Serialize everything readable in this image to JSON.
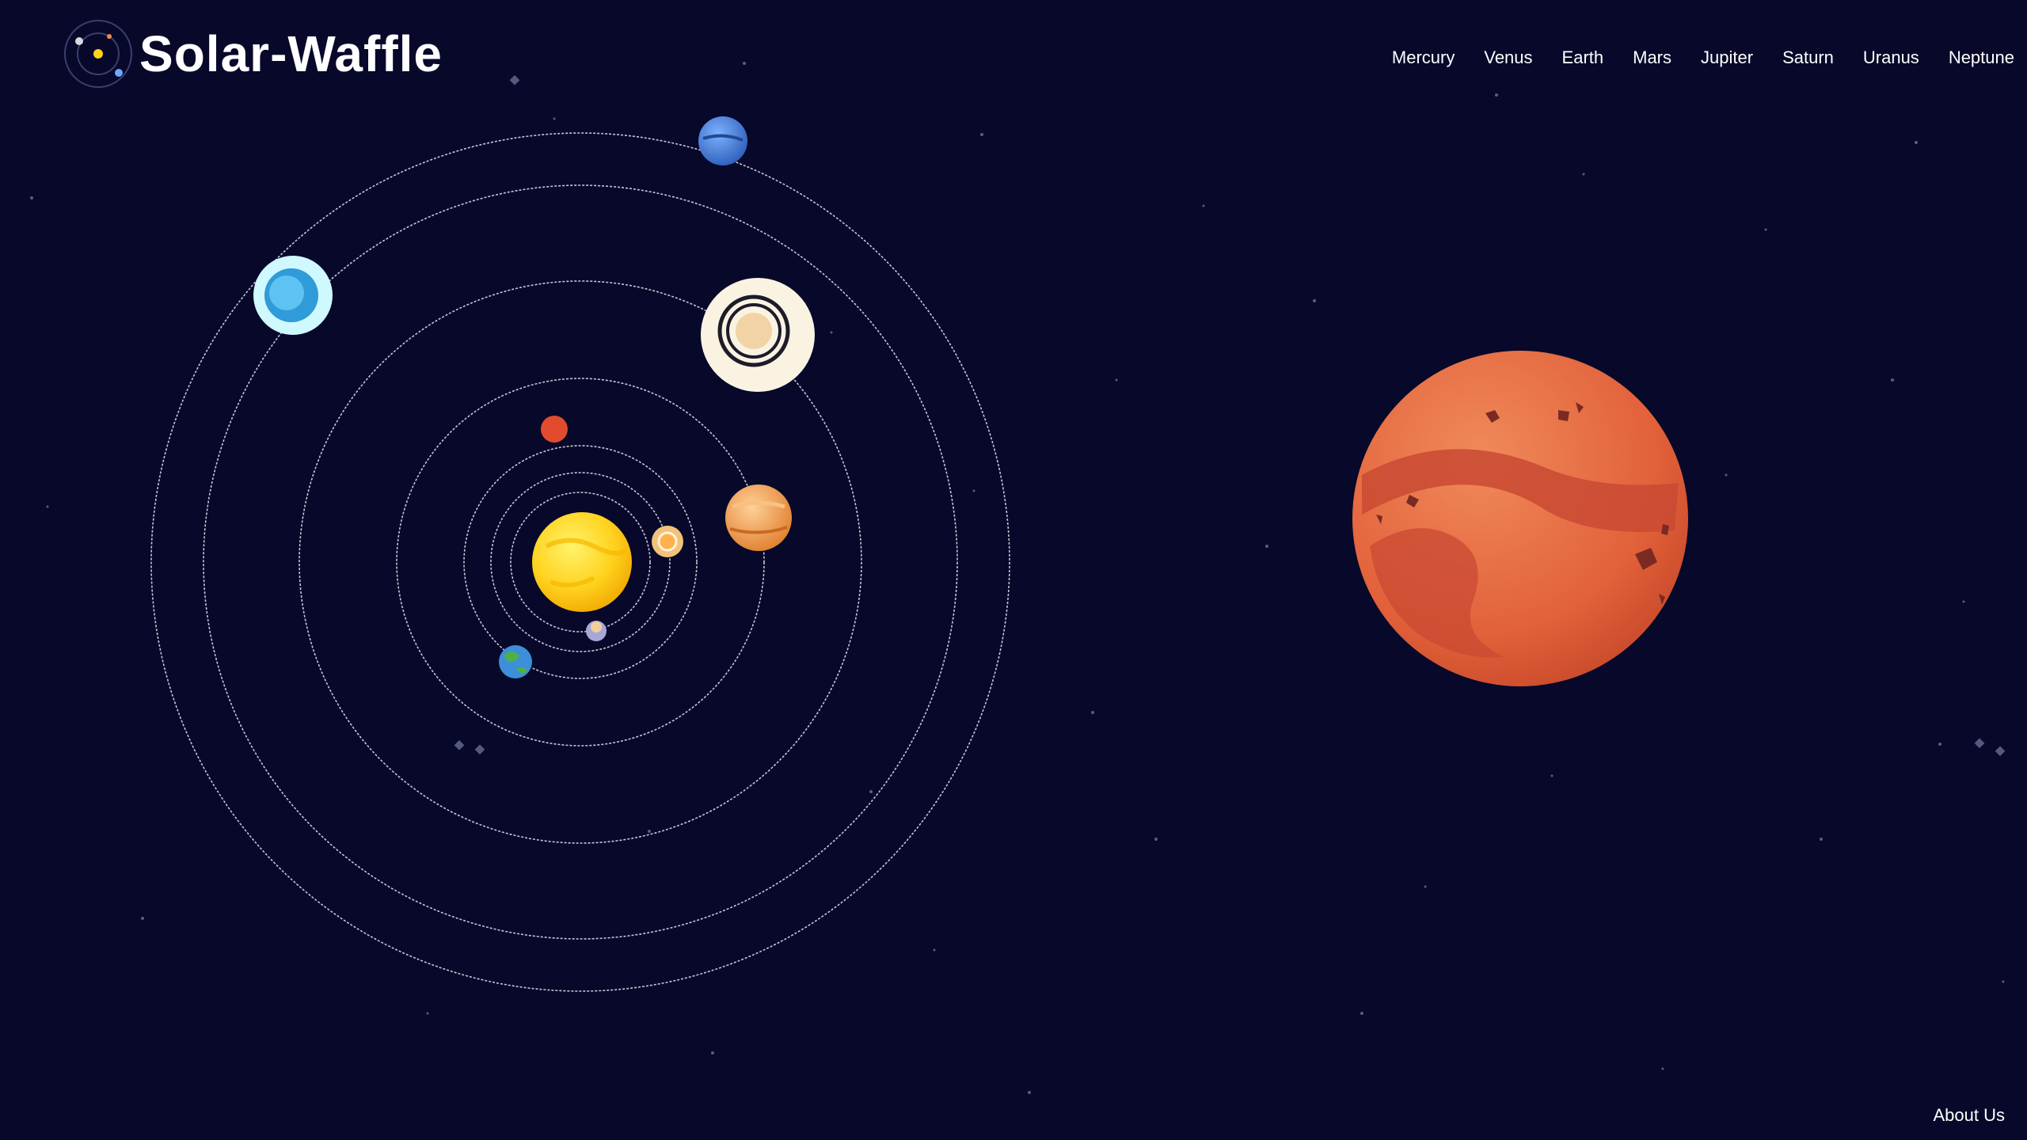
{
  "app": {
    "name": "Solar-Waffle"
  },
  "nav": {
    "items": [
      {
        "label": "Mercury"
      },
      {
        "label": "Venus"
      },
      {
        "label": "Earth"
      },
      {
        "label": "Mars"
      },
      {
        "label": "Jupiter"
      },
      {
        "label": "Saturn"
      },
      {
        "label": "Uranus"
      },
      {
        "label": "Neptune"
      }
    ]
  },
  "footer": {
    "about_label": "About Us"
  },
  "scene": {
    "featured_planet": "mars",
    "bodies": [
      "sun",
      "mercury",
      "venus",
      "earth",
      "mars",
      "jupiter",
      "saturn",
      "uranus",
      "neptune"
    ]
  },
  "colors": {
    "background": "#07082a",
    "text": "#ffffff",
    "orbit": "#e8e8f0",
    "sun": "#ffd21e",
    "mars": "#e2613a"
  }
}
